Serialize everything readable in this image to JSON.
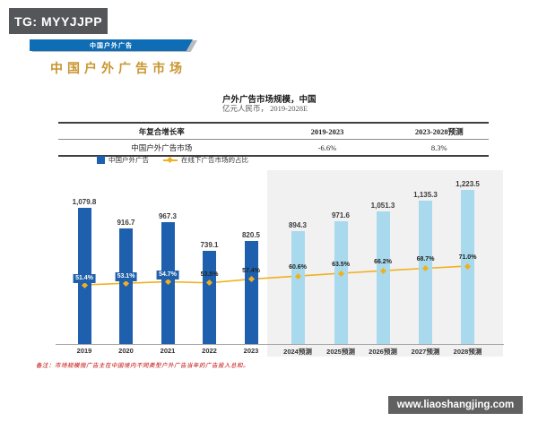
{
  "badge": {
    "text": "TG: MYYJJPP"
  },
  "banner": {
    "label": "中国户外广告"
  },
  "page_title": "中国户外广告市场",
  "chart_header": {
    "title": "户外广告市场规模，中国",
    "subtitle": "亿元人民币， 2019-2028E"
  },
  "table": {
    "headers": [
      "年复合增长率",
      "2019-2023",
      "2023-2028预测"
    ],
    "row": {
      "label": "中国户外广告市场",
      "cagr_2019_2023": "-6.6%",
      "cagr_2023_2028": "8.3%"
    }
  },
  "legend": {
    "bar_label": "中国户外广告",
    "line_label": "在线下广告市场的占比"
  },
  "chart_data": {
    "type": "bar",
    "categories": [
      "2019",
      "2020",
      "2021",
      "2022",
      "2023",
      "2024预测",
      "2025预测",
      "2026预测",
      "2027预测",
      "2028预测"
    ],
    "series": [
      {
        "name": "中国户外广告",
        "type": "bar",
        "values": [
          1079.8,
          916.7,
          967.3,
          739.1,
          820.5,
          894.3,
          971.6,
          1051.3,
          1135.3,
          1223.5
        ],
        "labels": [
          "1,079.8",
          "916.7",
          "967.3",
          "739.1",
          "820.5",
          "894.3",
          "971.6",
          "1,051.3",
          "1,135.3",
          "1,223.5"
        ]
      },
      {
        "name": "在线下广告市场的占比",
        "type": "line",
        "values": [
          51.4,
          53.1,
          54.7,
          53.5,
          57.4,
          60.6,
          63.5,
          66.2,
          68.7,
          71.0
        ],
        "labels": [
          "51.4%",
          "53.1%",
          "54.7%",
          "53.5%",
          "57.4%",
          "60.6%",
          "63.5%",
          "66.2%",
          "68.7%",
          "71.0%"
        ]
      }
    ],
    "forecast_start_index": 5,
    "boxed_pct_label_count": 3,
    "title": "户外广告市场规模，中国",
    "ylabel": "亿元人民币",
    "ylim": [
      0,
      1300
    ],
    "grid": false,
    "legend_position": "top",
    "colors": {
      "bar_actual": "#1e5fae",
      "bar_forecast": "#a9d9ec",
      "line": "#f2b01e",
      "forecast_panel": "#f1f1f2"
    }
  },
  "footnote": "备注：市场规模指广告主在中国境内不同类型户外广告当年的广告投入总和。",
  "watermark": {
    "url": "www.liaoshangjing.com"
  }
}
